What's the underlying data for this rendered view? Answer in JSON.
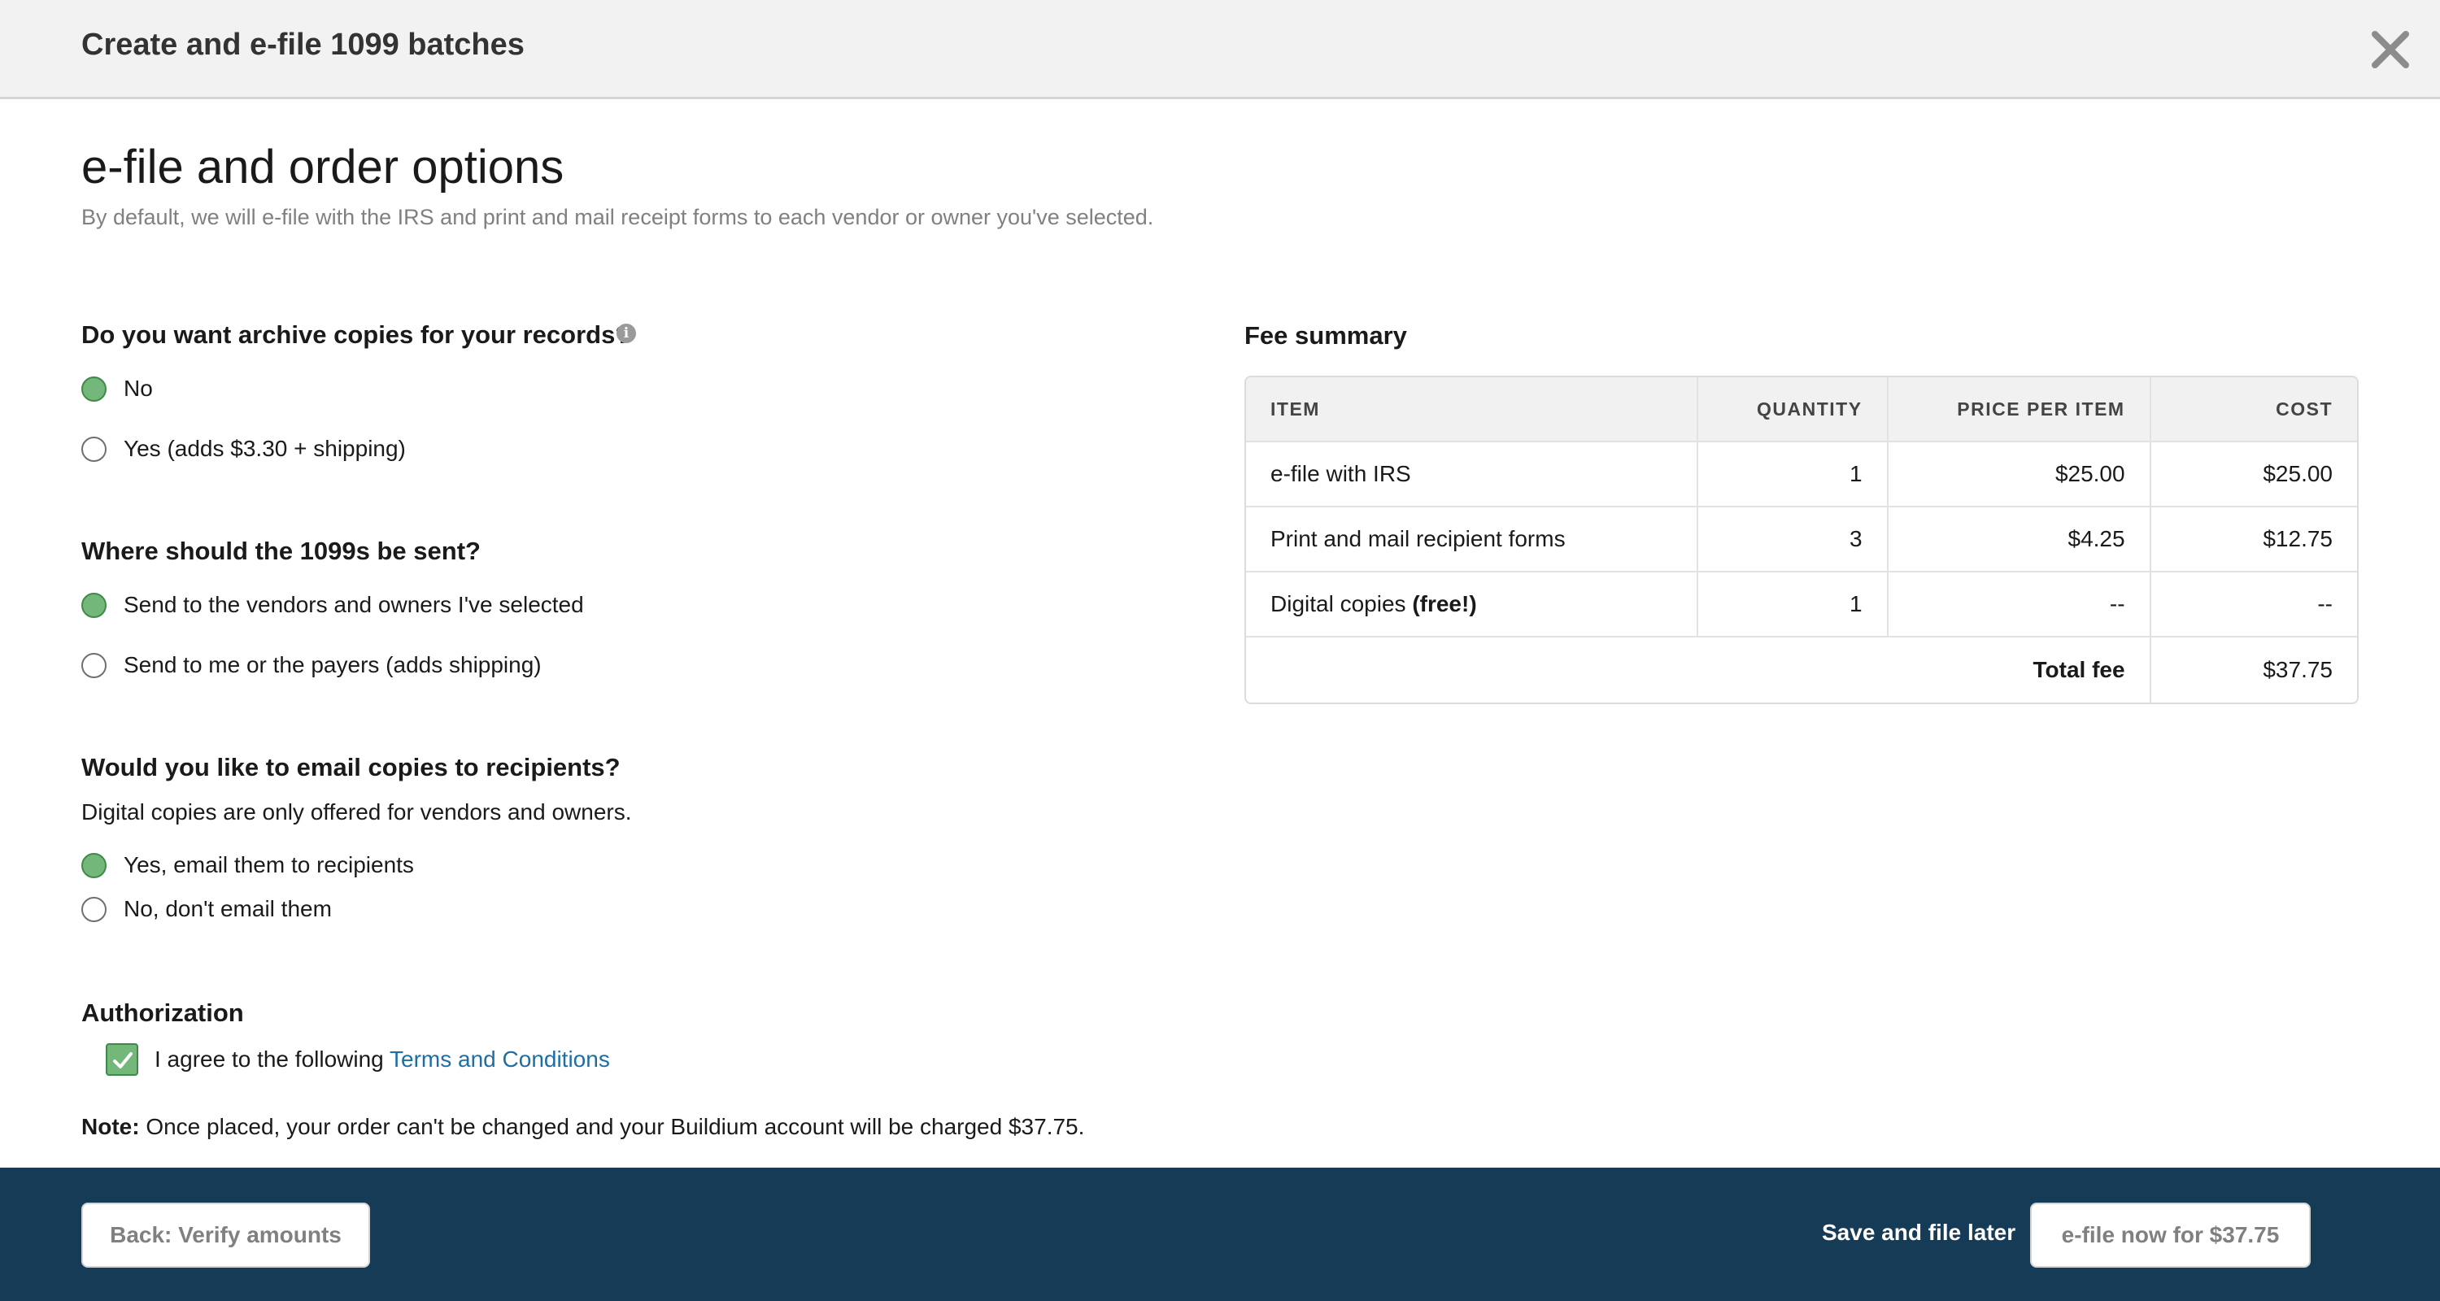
{
  "header": {
    "title": "Create and e-file 1099 batches",
    "close_icon": "close-icon"
  },
  "page": {
    "title": "e-file and order options",
    "subtitle": "By default, we will e-file with the IRS and print and mail receipt forms to each vendor or owner you've selected."
  },
  "archive": {
    "question": "Do you want archive copies for your records?",
    "info_icon": "i",
    "options": [
      {
        "label": "No",
        "checked": true
      },
      {
        "label": "Yes (adds $3.30 + shipping)",
        "checked": false
      }
    ]
  },
  "delivery": {
    "question": "Where should the 1099s be sent?",
    "options": [
      {
        "label": "Send to the vendors and owners I've selected",
        "checked": true
      },
      {
        "label": "Send to me or the payers (adds shipping)",
        "checked": false
      }
    ]
  },
  "email": {
    "question": "Would you like to email copies to recipients?",
    "helper": "Digital copies are only offered for vendors and owners.",
    "options": [
      {
        "label": "Yes, email them to recipients",
        "checked": true
      },
      {
        "label": "No, don't email them",
        "checked": false
      }
    ]
  },
  "authorization": {
    "title": "Authorization",
    "agree_text": "I agree to the following",
    "link_text": "Terms and Conditions",
    "checked": true
  },
  "note": {
    "label": "Note:",
    "text": "Once placed, your order can't be changed and your Buildium account will be charged $37.75."
  },
  "fee_summary": {
    "title": "Fee summary",
    "headers": {
      "item": "ITEM",
      "quantity": "QUANTITY",
      "price": "PRICE PER ITEM",
      "cost": "COST"
    },
    "rows": [
      {
        "item": "e-file with IRS",
        "item_bold": "",
        "quantity": "1",
        "price": "$25.00",
        "cost": "$25.00"
      },
      {
        "item": "Print and mail recipient forms",
        "item_bold": "",
        "quantity": "3",
        "price": "$4.25",
        "cost": "$12.75"
      },
      {
        "item": "Digital copies ",
        "item_bold": "(free!)",
        "quantity": "1",
        "price": "--",
        "cost": "--"
      }
    ],
    "total_label": "Total fee",
    "total_value": "$37.75"
  },
  "footer": {
    "back_label": "Back: Verify amounts",
    "save_label": "Save and file later",
    "efile_label": "e-file now for $37.75"
  },
  "colors": {
    "radio_checked": "#73b77a",
    "footer_bg": "#163b56",
    "link": "#1f6ea3"
  }
}
